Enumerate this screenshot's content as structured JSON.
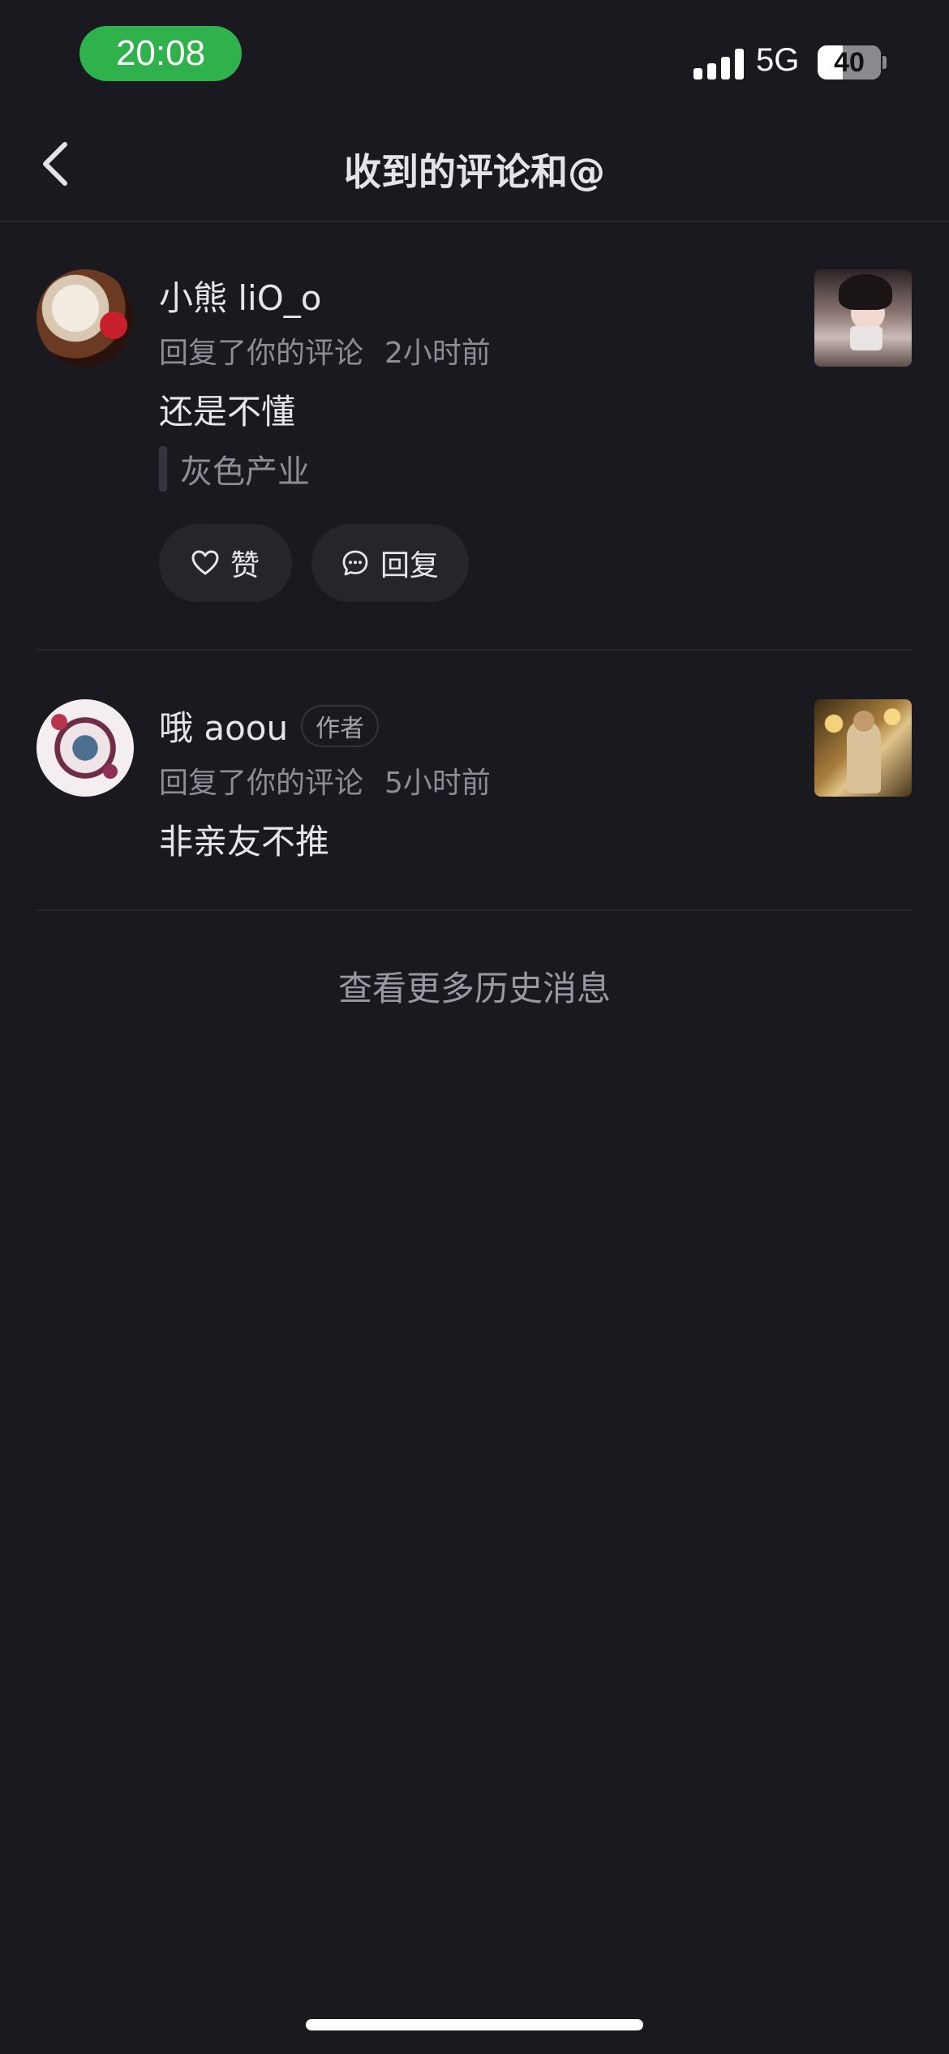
{
  "status_bar": {
    "time": "20:08",
    "network": "5G",
    "battery_level": "40",
    "battery_fraction": 0.4
  },
  "nav": {
    "title": "收到的评论和@",
    "back_icon": "chevron-left-icon"
  },
  "notifications": [
    {
      "username": "小熊 liO_o",
      "action": "回复了你的评论",
      "time": "2小时前",
      "content": "还是不懂",
      "quote": "灰色产业",
      "like_label": "赞",
      "reply_label": "回复"
    },
    {
      "username": "哦 aoou",
      "badge": "作者",
      "action": "回复了你的评论",
      "time": "5小时前",
      "content": "非亲友不推"
    }
  ],
  "more_link": "查看更多历史消息",
  "colors": {
    "background": "#1a1920",
    "time_pill": "#2fb24c",
    "text_primary": "#e6e5ec",
    "text_secondary": "#8e8d95",
    "button_bg": "#26252c"
  }
}
